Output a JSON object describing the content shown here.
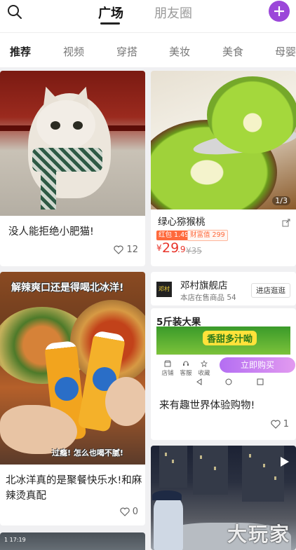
{
  "header": {
    "tabs": [
      {
        "label": "广场"
      },
      {
        "label": "朋友圈"
      }
    ],
    "add_label": "+"
  },
  "categories": [
    "推荐",
    "视频",
    "穿搭",
    "美妆",
    "美食",
    "母婴"
  ],
  "feed": {
    "cat_post": {
      "title": "没人能拒绝小肥猫!",
      "likes": "12"
    },
    "kiwi_post": {
      "title": "绿心猕猴桃",
      "image_counter": "1/3",
      "tag_red": "红包 1.49",
      "tag_outline": "财富值 299",
      "price_symbol": "¥",
      "price_int": "29",
      "price_dec": ".9",
      "orig_price": "¥35"
    },
    "drink_post": {
      "caption_top": "解辣爽口还是得喝北冰洋!",
      "caption_bottom": "过瘾! 怎么也喝不腻!",
      "title": "北冰洋真的是聚餐快乐水!和麻辣烫真配",
      "likes": "0"
    },
    "shop": {
      "logo_text": "邓村",
      "name": "邓村旗舰店",
      "count_label": "本店在售商品",
      "count": "54",
      "visit_label": "进店逛逛"
    },
    "product_post": {
      "banner_title": "5斤装大果",
      "slogan": "香甜多汁呦",
      "icons": [
        "店铺",
        "客服",
        "收藏"
      ],
      "buy_label": "立即购买",
      "title": "来有趣世界体验购物!",
      "likes": "1"
    },
    "video_post": {
      "watermark": "大玩家"
    },
    "peek_post": {
      "time": "1 17:19"
    }
  },
  "colors": {
    "accent": "#9b47d9",
    "price": "#e8352b",
    "tag": "#ff6a3c"
  }
}
